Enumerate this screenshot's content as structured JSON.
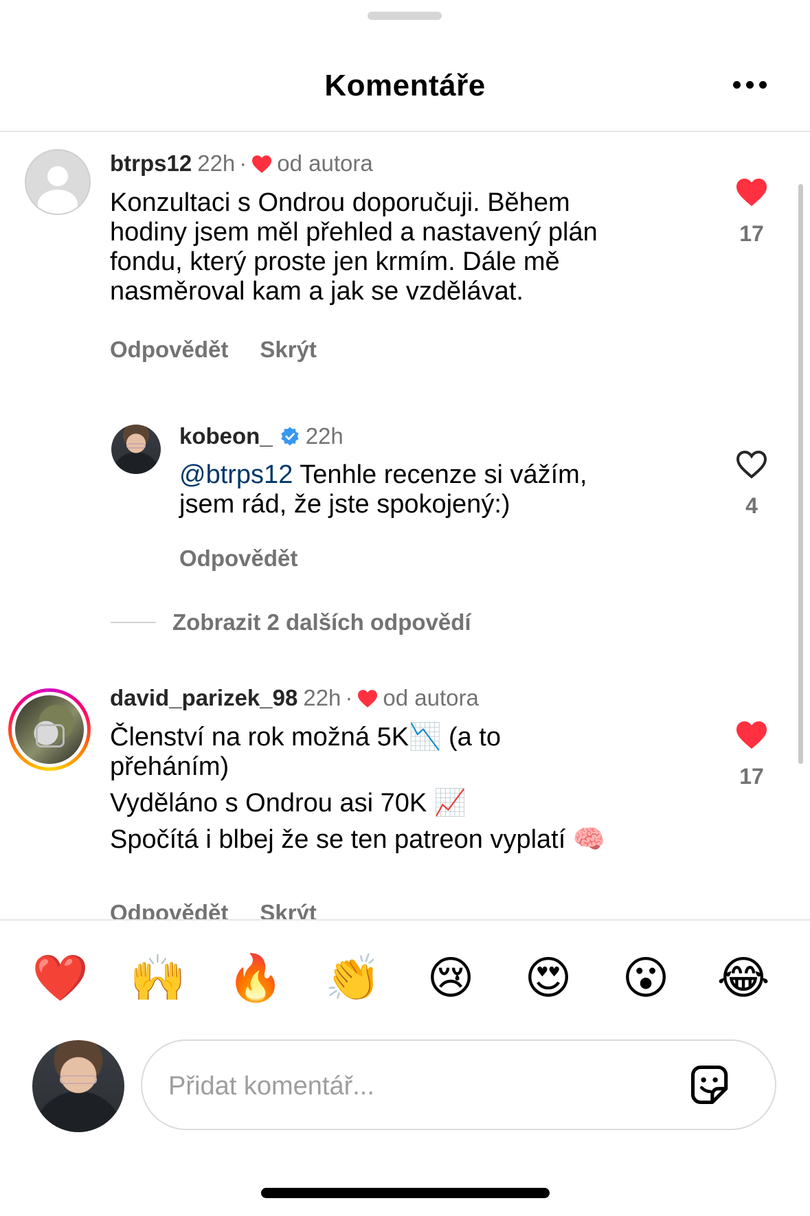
{
  "header": {
    "title": "Komentáře",
    "more_icon": "more-horizontal-icon"
  },
  "comments": [
    {
      "username": "btrps12",
      "time": "22h",
      "separator": "·",
      "author_liked": "od autora",
      "text_lines": [
        "Konzultaci s Ondrou doporučuji. Během",
        "hodiny jsem měl přehled a nastavený plán",
        "fondu, který proste jen krmím. Dále mě",
        "nasměroval kam a jak se vzdělávat."
      ],
      "reply_label": "Odpovědět",
      "hide_label": "Skrýt",
      "liked": true,
      "likes": "17"
    },
    {
      "username": "kobeon_",
      "verified": true,
      "time": "22h",
      "mention": "@btrps12",
      "text_line1": "Tenhle recenze si vážím,",
      "text_line2": "jsem rád, že jste spokojený:)",
      "reply_label": "Odpovědět",
      "liked": false,
      "likes": "4"
    },
    {
      "username": "david_parizek_98",
      "time": "22h",
      "separator": "·",
      "author_liked": "od autora",
      "text_lines": [
        "Členství na rok možná 5K📉  (a to",
        "přeháním)",
        "Vyděláno s Ondrou asi 70K 📈",
        "Spočítá i blbej že se ten patreon vyplatí 🧠"
      ],
      "reply_label": "Odpovědět",
      "hide_label": "Skrýt",
      "liked": true,
      "likes": "17"
    }
  ],
  "more_replies": "Zobrazit 2 dalších odpovědí",
  "quick_reactions": [
    "❤️",
    "🙌",
    "🔥",
    "👏",
    "😢",
    "😍",
    "😮",
    "😂"
  ],
  "composer": {
    "placeholder": "Přidat komentář...",
    "value": "",
    "sticker_icon": "sticker-icon"
  },
  "colors": {
    "like_red": "#ff3040",
    "muted": "#737373",
    "mention": "#00376b",
    "verified_blue": "#0095f6"
  }
}
